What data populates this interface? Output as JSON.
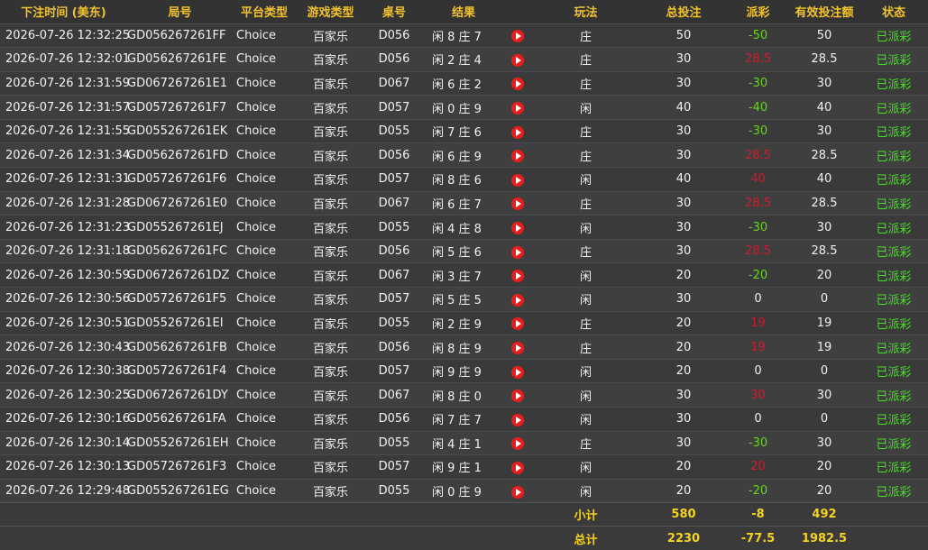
{
  "headers": {
    "time": "下注时间 (美东)",
    "round_no": "局号",
    "platform": "平台类型",
    "game_type": "游戏类型",
    "table_no": "桌号",
    "result": "结果",
    "bet_type": "玩法",
    "total_bet": "总投注",
    "payout": "派彩",
    "valid_bet": "有效投注额",
    "status": "状态"
  },
  "rows": [
    {
      "time": "2026-07-26 12:32:25",
      "round": "GD056267261FF",
      "platform": "Choice",
      "game": "百家乐",
      "table": "D056",
      "result": "闲 8 庄 7",
      "bet": "庄",
      "total": "50",
      "payout": "-50",
      "sign": "neg",
      "valid": "50",
      "status": "已派彩"
    },
    {
      "time": "2026-07-26 12:32:01",
      "round": "GD056267261FE",
      "platform": "Choice",
      "game": "百家乐",
      "table": "D056",
      "result": "闲 2 庄 4",
      "bet": "庄",
      "total": "30",
      "payout": "28.5",
      "sign": "pos",
      "valid": "28.5",
      "status": "已派彩"
    },
    {
      "time": "2026-07-26 12:31:59",
      "round": "GD067267261E1",
      "platform": "Choice",
      "game": "百家乐",
      "table": "D067",
      "result": "闲 6 庄 2",
      "bet": "庄",
      "total": "30",
      "payout": "-30",
      "sign": "neg",
      "valid": "30",
      "status": "已派彩"
    },
    {
      "time": "2026-07-26 12:31:57",
      "round": "GD057267261F7",
      "platform": "Choice",
      "game": "百家乐",
      "table": "D057",
      "result": "闲 0 庄 9",
      "bet": "闲",
      "total": "40",
      "payout": "-40",
      "sign": "neg",
      "valid": "40",
      "status": "已派彩"
    },
    {
      "time": "2026-07-26 12:31:55",
      "round": "GD055267261EK",
      "platform": "Choice",
      "game": "百家乐",
      "table": "D055",
      "result": "闲 7 庄 6",
      "bet": "庄",
      "total": "30",
      "payout": "-30",
      "sign": "neg",
      "valid": "30",
      "status": "已派彩"
    },
    {
      "time": "2026-07-26 12:31:34",
      "round": "GD056267261FD",
      "platform": "Choice",
      "game": "百家乐",
      "table": "D056",
      "result": "闲 6 庄 9",
      "bet": "庄",
      "total": "30",
      "payout": "28.5",
      "sign": "pos",
      "valid": "28.5",
      "status": "已派彩"
    },
    {
      "time": "2026-07-26 12:31:31",
      "round": "GD057267261F6",
      "platform": "Choice",
      "game": "百家乐",
      "table": "D057",
      "result": "闲 8 庄 6",
      "bet": "闲",
      "total": "40",
      "payout": "40",
      "sign": "pos",
      "valid": "40",
      "status": "已派彩"
    },
    {
      "time": "2026-07-26 12:31:28",
      "round": "GD067267261E0",
      "platform": "Choice",
      "game": "百家乐",
      "table": "D067",
      "result": "闲 6 庄 7",
      "bet": "庄",
      "total": "30",
      "payout": "28.5",
      "sign": "pos",
      "valid": "28.5",
      "status": "已派彩"
    },
    {
      "time": "2026-07-26 12:31:23",
      "round": "GD055267261EJ",
      "platform": "Choice",
      "game": "百家乐",
      "table": "D055",
      "result": "闲 4 庄 8",
      "bet": "闲",
      "total": "30",
      "payout": "-30",
      "sign": "neg",
      "valid": "30",
      "status": "已派彩"
    },
    {
      "time": "2026-07-26 12:31:18",
      "round": "GD056267261FC",
      "platform": "Choice",
      "game": "百家乐",
      "table": "D056",
      "result": "闲 5 庄 6",
      "bet": "庄",
      "total": "30",
      "payout": "28.5",
      "sign": "pos",
      "valid": "28.5",
      "status": "已派彩"
    },
    {
      "time": "2026-07-26 12:30:59",
      "round": "GD067267261DZ",
      "platform": "Choice",
      "game": "百家乐",
      "table": "D067",
      "result": "闲 3 庄 7",
      "bet": "闲",
      "total": "20",
      "payout": "-20",
      "sign": "neg",
      "valid": "20",
      "status": "已派彩"
    },
    {
      "time": "2026-07-26 12:30:56",
      "round": "GD057267261F5",
      "platform": "Choice",
      "game": "百家乐",
      "table": "D057",
      "result": "闲 5 庄 5",
      "bet": "闲",
      "total": "30",
      "payout": "0",
      "sign": "zero",
      "valid": "0",
      "status": "已派彩"
    },
    {
      "time": "2026-07-26 12:30:51",
      "round": "GD055267261EI",
      "platform": "Choice",
      "game": "百家乐",
      "table": "D055",
      "result": "闲 2 庄 9",
      "bet": "庄",
      "total": "20",
      "payout": "19",
      "sign": "pos",
      "valid": "19",
      "status": "已派彩"
    },
    {
      "time": "2026-07-26 12:30:43",
      "round": "GD056267261FB",
      "platform": "Choice",
      "game": "百家乐",
      "table": "D056",
      "result": "闲 8 庄 9",
      "bet": "庄",
      "total": "20",
      "payout": "19",
      "sign": "pos",
      "valid": "19",
      "status": "已派彩"
    },
    {
      "time": "2026-07-26 12:30:38",
      "round": "GD057267261F4",
      "platform": "Choice",
      "game": "百家乐",
      "table": "D057",
      "result": "闲 9 庄 9",
      "bet": "闲",
      "total": "20",
      "payout": "0",
      "sign": "zero",
      "valid": "0",
      "status": "已派彩"
    },
    {
      "time": "2026-07-26 12:30:25",
      "round": "GD067267261DY",
      "platform": "Choice",
      "game": "百家乐",
      "table": "D067",
      "result": "闲 8 庄 0",
      "bet": "闲",
      "total": "30",
      "payout": "30",
      "sign": "pos",
      "valid": "30",
      "status": "已派彩"
    },
    {
      "time": "2026-07-26 12:30:16",
      "round": "GD056267261FA",
      "platform": "Choice",
      "game": "百家乐",
      "table": "D056",
      "result": "闲 7 庄 7",
      "bet": "闲",
      "total": "30",
      "payout": "0",
      "sign": "zero",
      "valid": "0",
      "status": "已派彩"
    },
    {
      "time": "2026-07-26 12:30:14",
      "round": "GD055267261EH",
      "platform": "Choice",
      "game": "百家乐",
      "table": "D055",
      "result": "闲 4 庄 1",
      "bet": "庄",
      "total": "30",
      "payout": "-30",
      "sign": "neg",
      "valid": "30",
      "status": "已派彩"
    },
    {
      "time": "2026-07-26 12:30:13",
      "round": "GD057267261F3",
      "platform": "Choice",
      "game": "百家乐",
      "table": "D057",
      "result": "闲 9 庄 1",
      "bet": "闲",
      "total": "20",
      "payout": "20",
      "sign": "pos",
      "valid": "20",
      "status": "已派彩"
    },
    {
      "time": "2026-07-26 12:29:48",
      "round": "GD055267261EG",
      "platform": "Choice",
      "game": "百家乐",
      "table": "D055",
      "result": "闲 0 庄 9",
      "bet": "闲",
      "total": "20",
      "payout": "-20",
      "sign": "neg",
      "valid": "20",
      "status": "已派彩"
    }
  ],
  "subtotal": {
    "label": "小计",
    "total": "580",
    "payout": "-8",
    "valid": "492"
  },
  "grand_total": {
    "label": "总计",
    "total": "2230",
    "payout": "-77.5",
    "valid": "1982.5"
  },
  "icons": {
    "replay": "play-circle-icon"
  },
  "colors": {
    "header": "#f2c230",
    "negative": "#64d41e",
    "positive": "#c81e32",
    "status": "#45e021",
    "play": "#e81d1d"
  }
}
